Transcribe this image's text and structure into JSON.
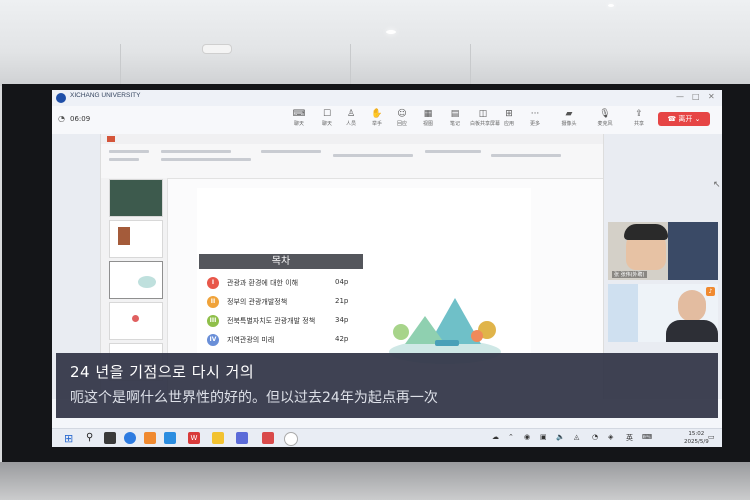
{
  "window": {
    "title": "XICHANG UNIVERSITY",
    "controls": [
      "—",
      "□",
      "✕"
    ]
  },
  "toolbar": {
    "timer": "06:09",
    "items": [
      {
        "label": "聊天",
        "icon": "chat-icon"
      },
      {
        "label": "聊天",
        "icon": "message-icon"
      },
      {
        "label": "人员",
        "icon": "people-icon"
      },
      {
        "label": "举手",
        "icon": "hand-icon"
      },
      {
        "label": "回应",
        "icon": "reaction-icon"
      },
      {
        "label": "视图",
        "icon": "layout-icon"
      },
      {
        "label": "笔记",
        "icon": "notes-icon"
      },
      {
        "label": "白板共享屏幕",
        "icon": "whiteboard-icon"
      },
      {
        "label": "应用",
        "icon": "apps-icon"
      },
      {
        "label": "更多",
        "icon": "more-icon"
      },
      {
        "label": "摄像头",
        "icon": "camera-icon"
      },
      {
        "label": "麦克风",
        "icon": "microphone-icon"
      },
      {
        "label": "共享",
        "icon": "share-icon"
      }
    ],
    "leave_label": "离开"
  },
  "slide": {
    "heading": "목차",
    "toc": [
      {
        "num": "I",
        "text": "관광과 환경에 대한 이해",
        "page": "04p",
        "color": "#e8574a"
      },
      {
        "num": "II",
        "text": "정부의 관광개발정책",
        "page": "21p",
        "color": "#f0a33a"
      },
      {
        "num": "III",
        "text": "전북특별자치도 관광개발 정책",
        "page": "34p",
        "color": "#8fbf4a"
      },
      {
        "num": "IV",
        "text": "지역관광의 미래",
        "page": "42p",
        "color": "#6a8fd8"
      }
    ]
  },
  "participants": [
    {
      "name": "张 张伟(外聘)"
    }
  ],
  "subtitles": {
    "korean": "24 년을 기점으로 다시 거의",
    "chinese": "呃这个是啊什么世界性的好的。但以过去24年为起点再一次"
  },
  "taskbar": {
    "ime": "英",
    "time": "15:02",
    "date": "2025/5/9"
  }
}
